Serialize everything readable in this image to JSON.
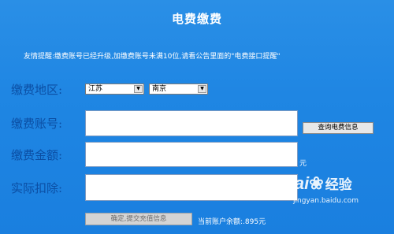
{
  "title": "电费缴费",
  "notice": "友情提醒:缴费账号已经升级,加缴费账号未满10位,请看公告里面的\"电费接口提醒\"",
  "form": {
    "region_label": "缴费地区:",
    "province_value": "江苏",
    "city_value": "南京",
    "account_label": "缴费账号:",
    "amount_label": "缴费金额:",
    "amount_unit": "元",
    "deduction_label": "实际扣除:",
    "query_button": "查询电费信息",
    "submit_button": "确定,提交充值信息",
    "balance_text": "当前账户余额:.895元"
  },
  "watermark": {
    "brand": "Bai",
    "brand2": "经验",
    "url": "jingyan.baidu.com"
  },
  "colors": {
    "background": "#1f86e3",
    "label": "#0b4ea3"
  }
}
